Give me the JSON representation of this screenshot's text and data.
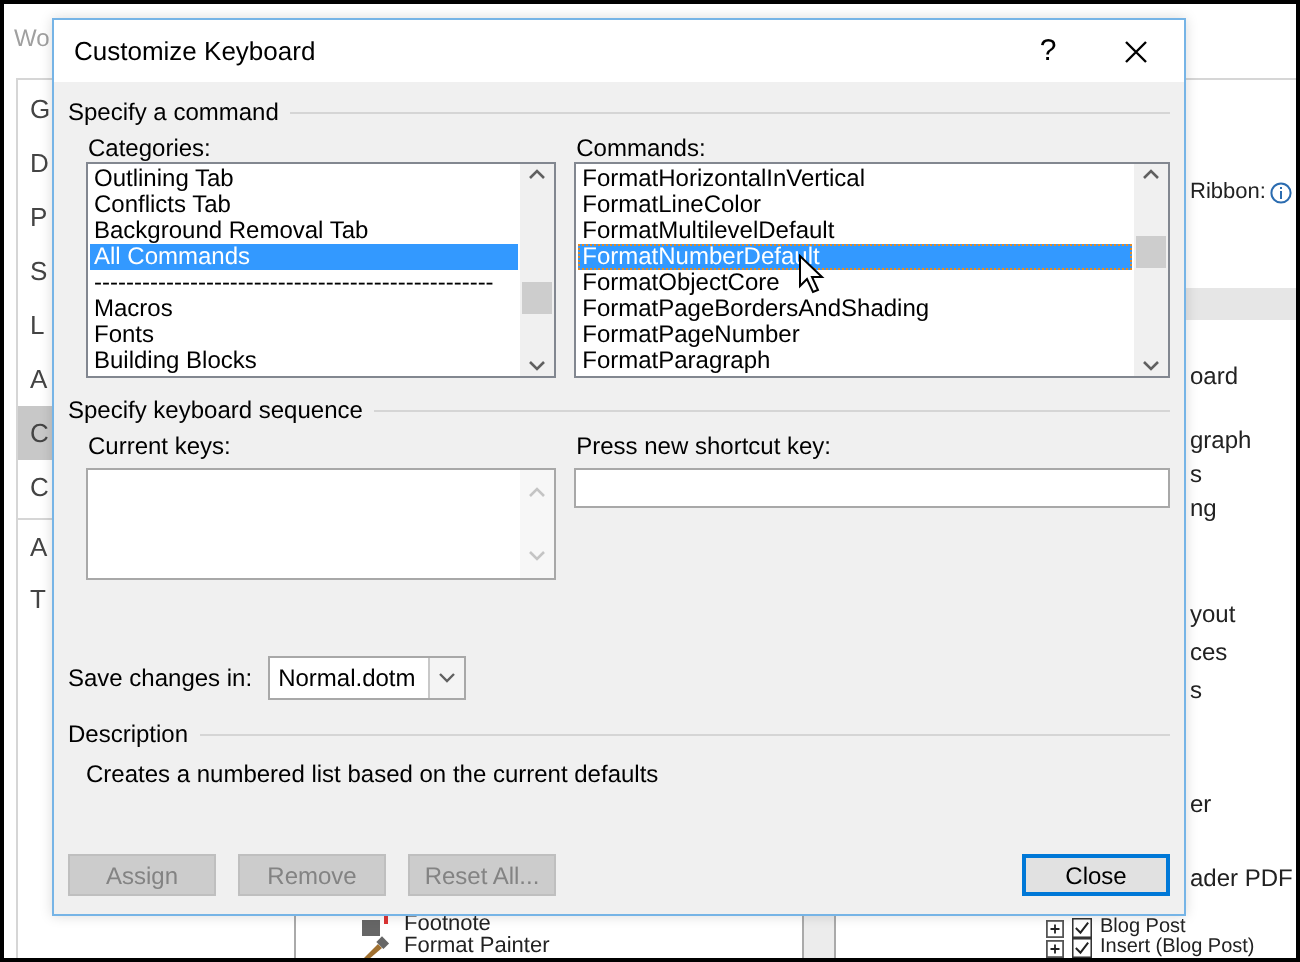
{
  "background_window": {
    "title": "Wo",
    "sidebar": [
      {
        "label": "G",
        "selected": false
      },
      {
        "label": "D",
        "selected": false
      },
      {
        "label": "P",
        "selected": false
      },
      {
        "label": "S",
        "selected": false
      },
      {
        "label": "L",
        "selected": false
      },
      {
        "label": "A",
        "selected": false
      },
      {
        "label": "C",
        "selected": true
      },
      {
        "label": "C",
        "selected": false
      },
      {
        "label": "A",
        "selected": false
      },
      {
        "label": "T",
        "selected": false
      }
    ],
    "ribbon_label": "Ribbon:",
    "tree_items": [
      "oard",
      "graph",
      "s",
      "ng",
      "yout",
      "ces",
      "s",
      "er",
      "ader PDF"
    ],
    "tree_checkboxes": [
      {
        "label": "Blog Post",
        "checked": true
      },
      {
        "label": "Insert (Blog Post)",
        "checked": true
      }
    ],
    "commands_list": [
      "Footnote",
      "Format Painter"
    ]
  },
  "dialog": {
    "title": "Customize Keyboard",
    "help": "?",
    "command_group": "Specify a command",
    "categories": {
      "label": "Categories:",
      "items": [
        {
          "label": "Outlining Tab",
          "selected": false
        },
        {
          "label": "Conflicts Tab",
          "selected": false
        },
        {
          "label": "Background Removal Tab",
          "selected": false
        },
        {
          "label": "All Commands",
          "selected": true
        },
        {
          "label": "--------------------------------------------------",
          "selected": false
        },
        {
          "label": "Macros",
          "selected": false
        },
        {
          "label": "Fonts",
          "selected": false
        },
        {
          "label": "Building Blocks",
          "selected": false
        }
      ]
    },
    "commands": {
      "label": "Commands:",
      "items": [
        {
          "label": "FormatHorizontalInVertical",
          "selected": false
        },
        {
          "label": "FormatLineColor",
          "selected": false
        },
        {
          "label": "FormatMultilevelDefault",
          "selected": false
        },
        {
          "label": "FormatNumberDefault",
          "selected": true
        },
        {
          "label": "FormatObjectCore",
          "selected": false
        },
        {
          "label": "FormatPageBordersAndShading",
          "selected": false
        },
        {
          "label": "FormatPageNumber",
          "selected": false
        },
        {
          "label": "FormatParagraph",
          "selected": false
        }
      ]
    },
    "keyboard_group": "Specify keyboard sequence",
    "current_keys_label": "Current keys:",
    "new_key_label": "Press new shortcut key:",
    "save_label": "Save changes in:",
    "save_value": "Normal.dotm",
    "description_group": "Description",
    "description": "Creates a numbered list based on the current defaults",
    "buttons": [
      {
        "label": "Assign",
        "disabled": true,
        "focused": false
      },
      {
        "label": "Remove",
        "disabled": true,
        "focused": false
      },
      {
        "label": "Reset All...",
        "disabled": true,
        "focused": false
      },
      {
        "label": "Close",
        "disabled": false,
        "focused": true
      }
    ]
  }
}
